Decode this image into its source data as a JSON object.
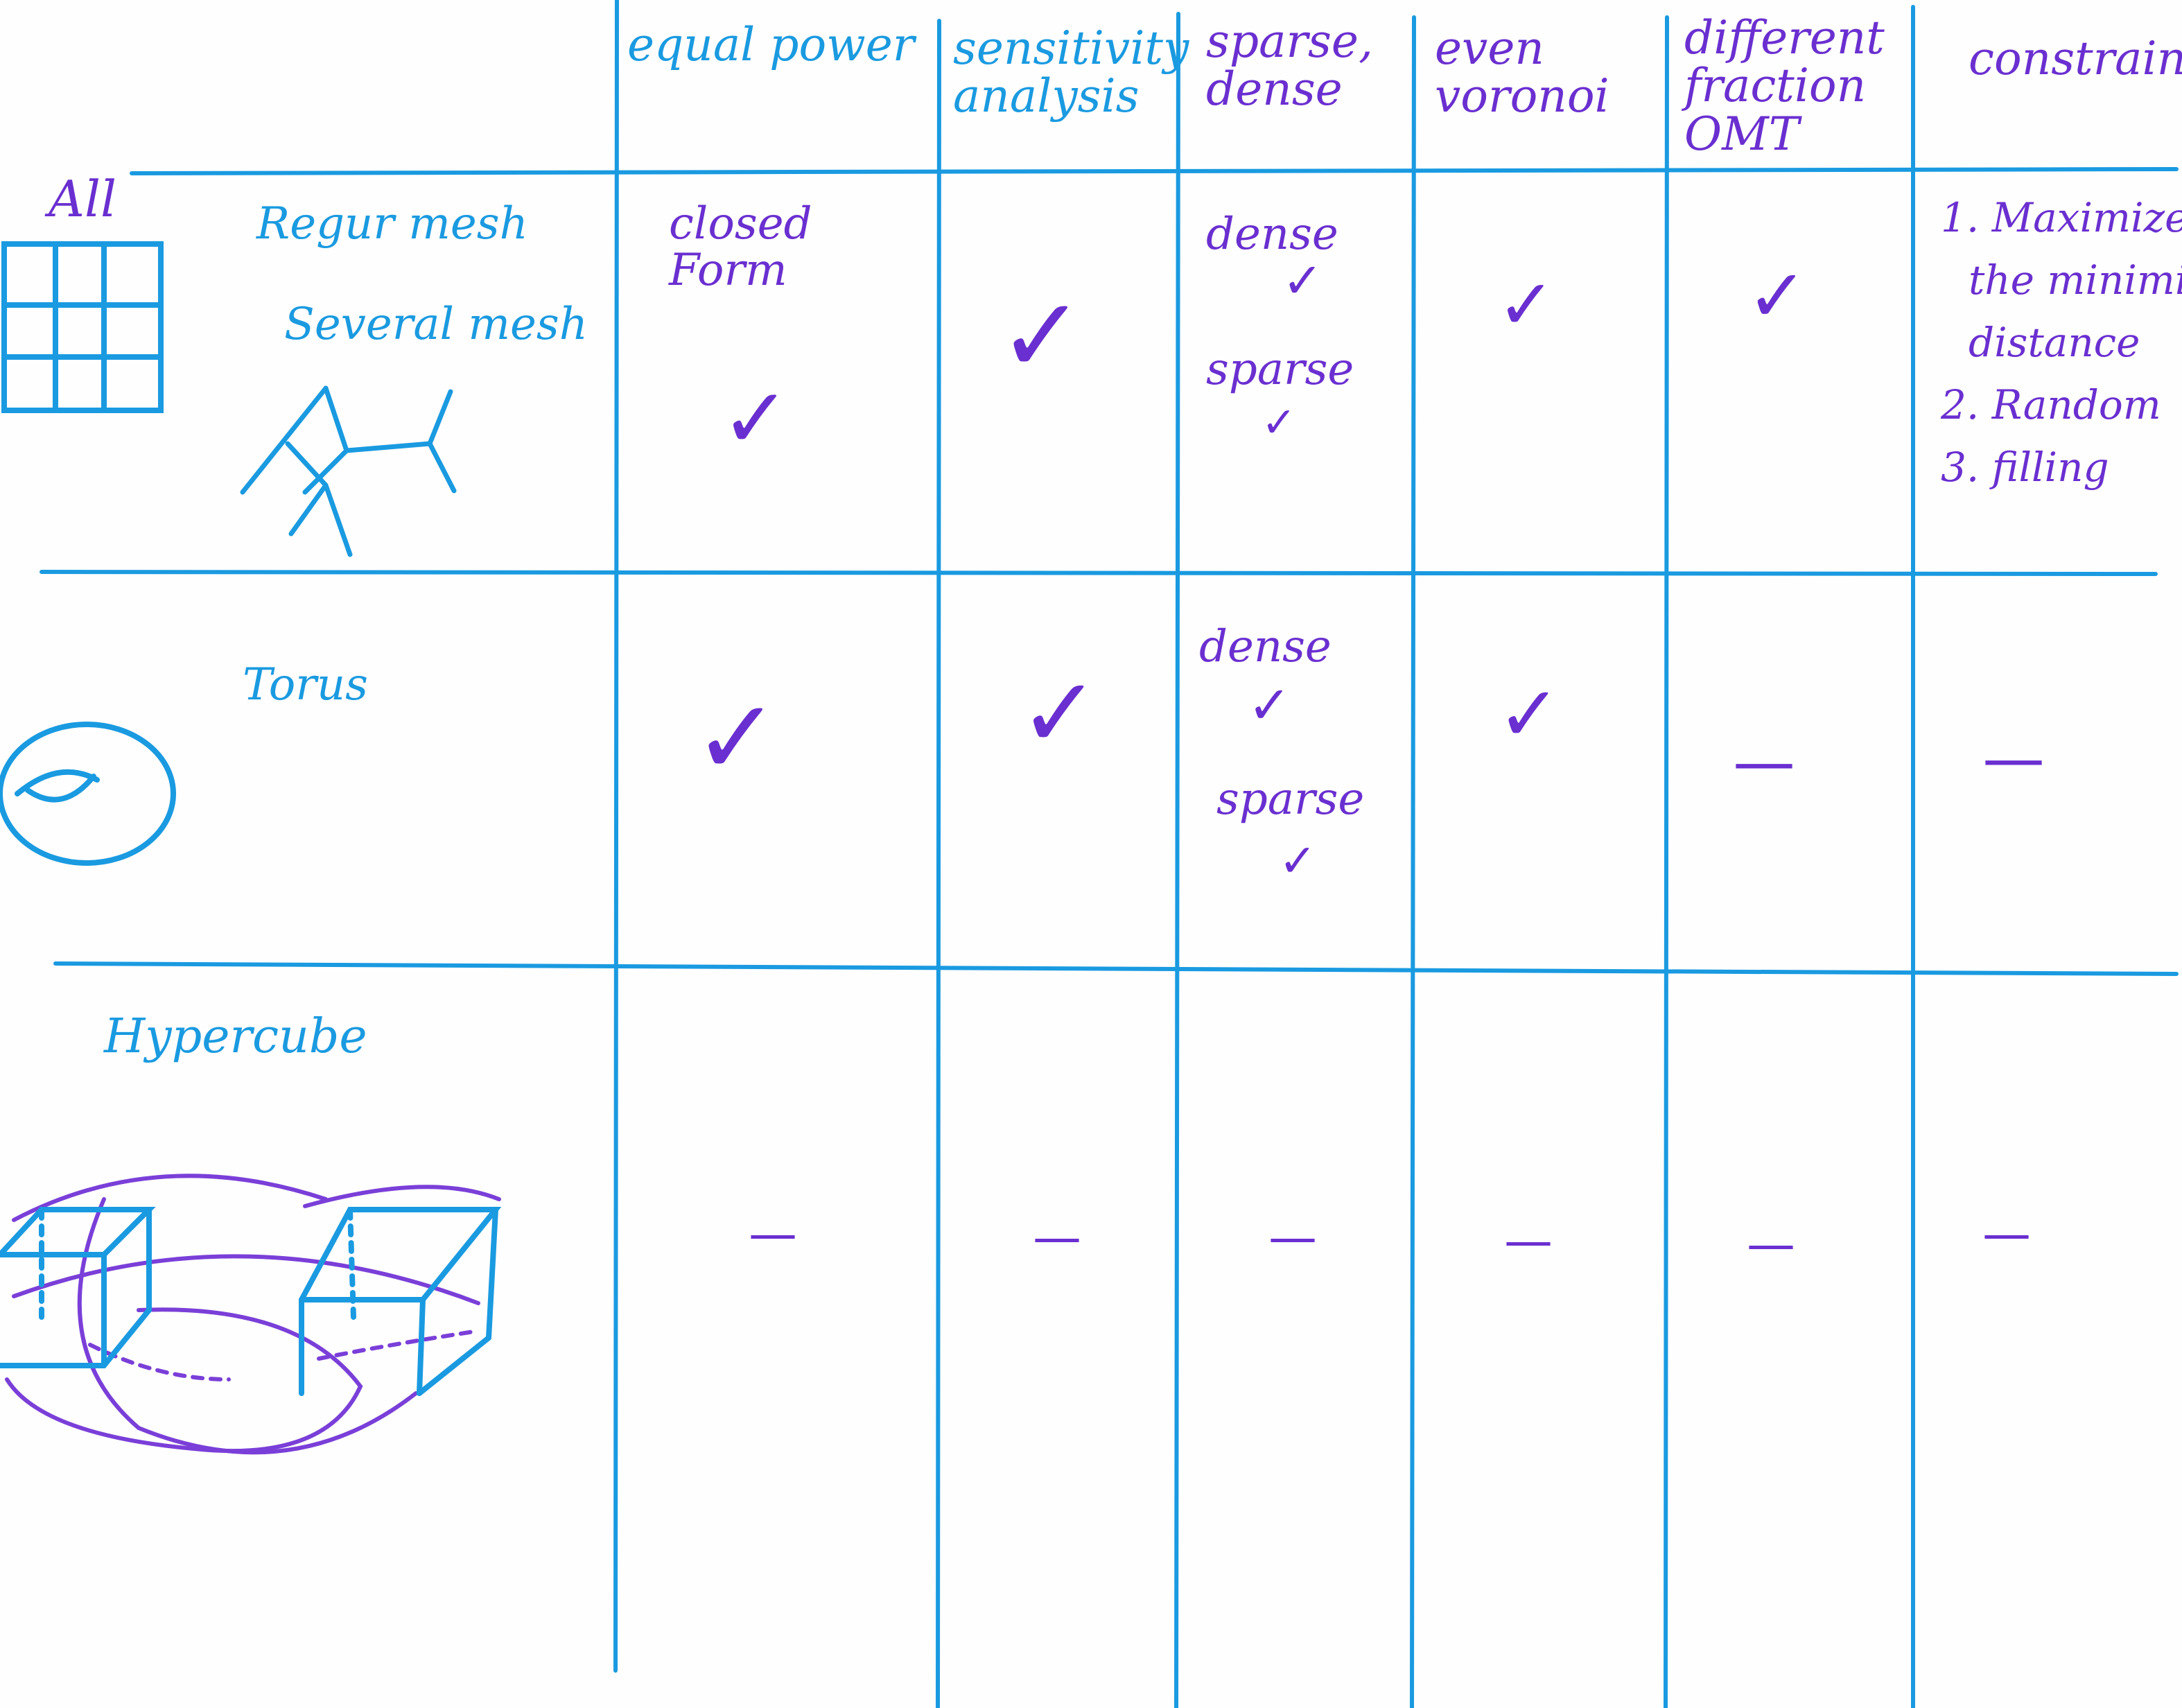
{
  "colors": {
    "blue_ink": "#1a9ae0",
    "purple_ink": "#6a2fd0",
    "paper": "#fefefe"
  },
  "headers": [
    "equal power",
    "sensitivity analysis",
    "sparse, dense",
    "even voronoi",
    "different fraction OMT",
    "constrain"
  ],
  "rows": [
    {
      "label_top": "All",
      "labels": [
        "Regur mesh",
        "Several mesh"
      ],
      "sketch": "grid-mesh and branching-mesh"
    },
    {
      "labels": [
        "Torus"
      ],
      "sketch": "torus"
    },
    {
      "labels": [
        "Hypercube"
      ],
      "sketch": "hypercube"
    }
  ],
  "cells": {
    "r1_equal_power": [
      "closed",
      "Form"
    ],
    "r1_sparse_dense": [
      "dense",
      "sparse"
    ],
    "r1_constrain": [
      "1. Maximize",
      "the minimize",
      "distance",
      "2. Random",
      "3. filling"
    ],
    "r2_sparse_dense": [
      "dense",
      "sparse"
    ]
  },
  "marks": {
    "check": "✓",
    "dash": "—"
  }
}
